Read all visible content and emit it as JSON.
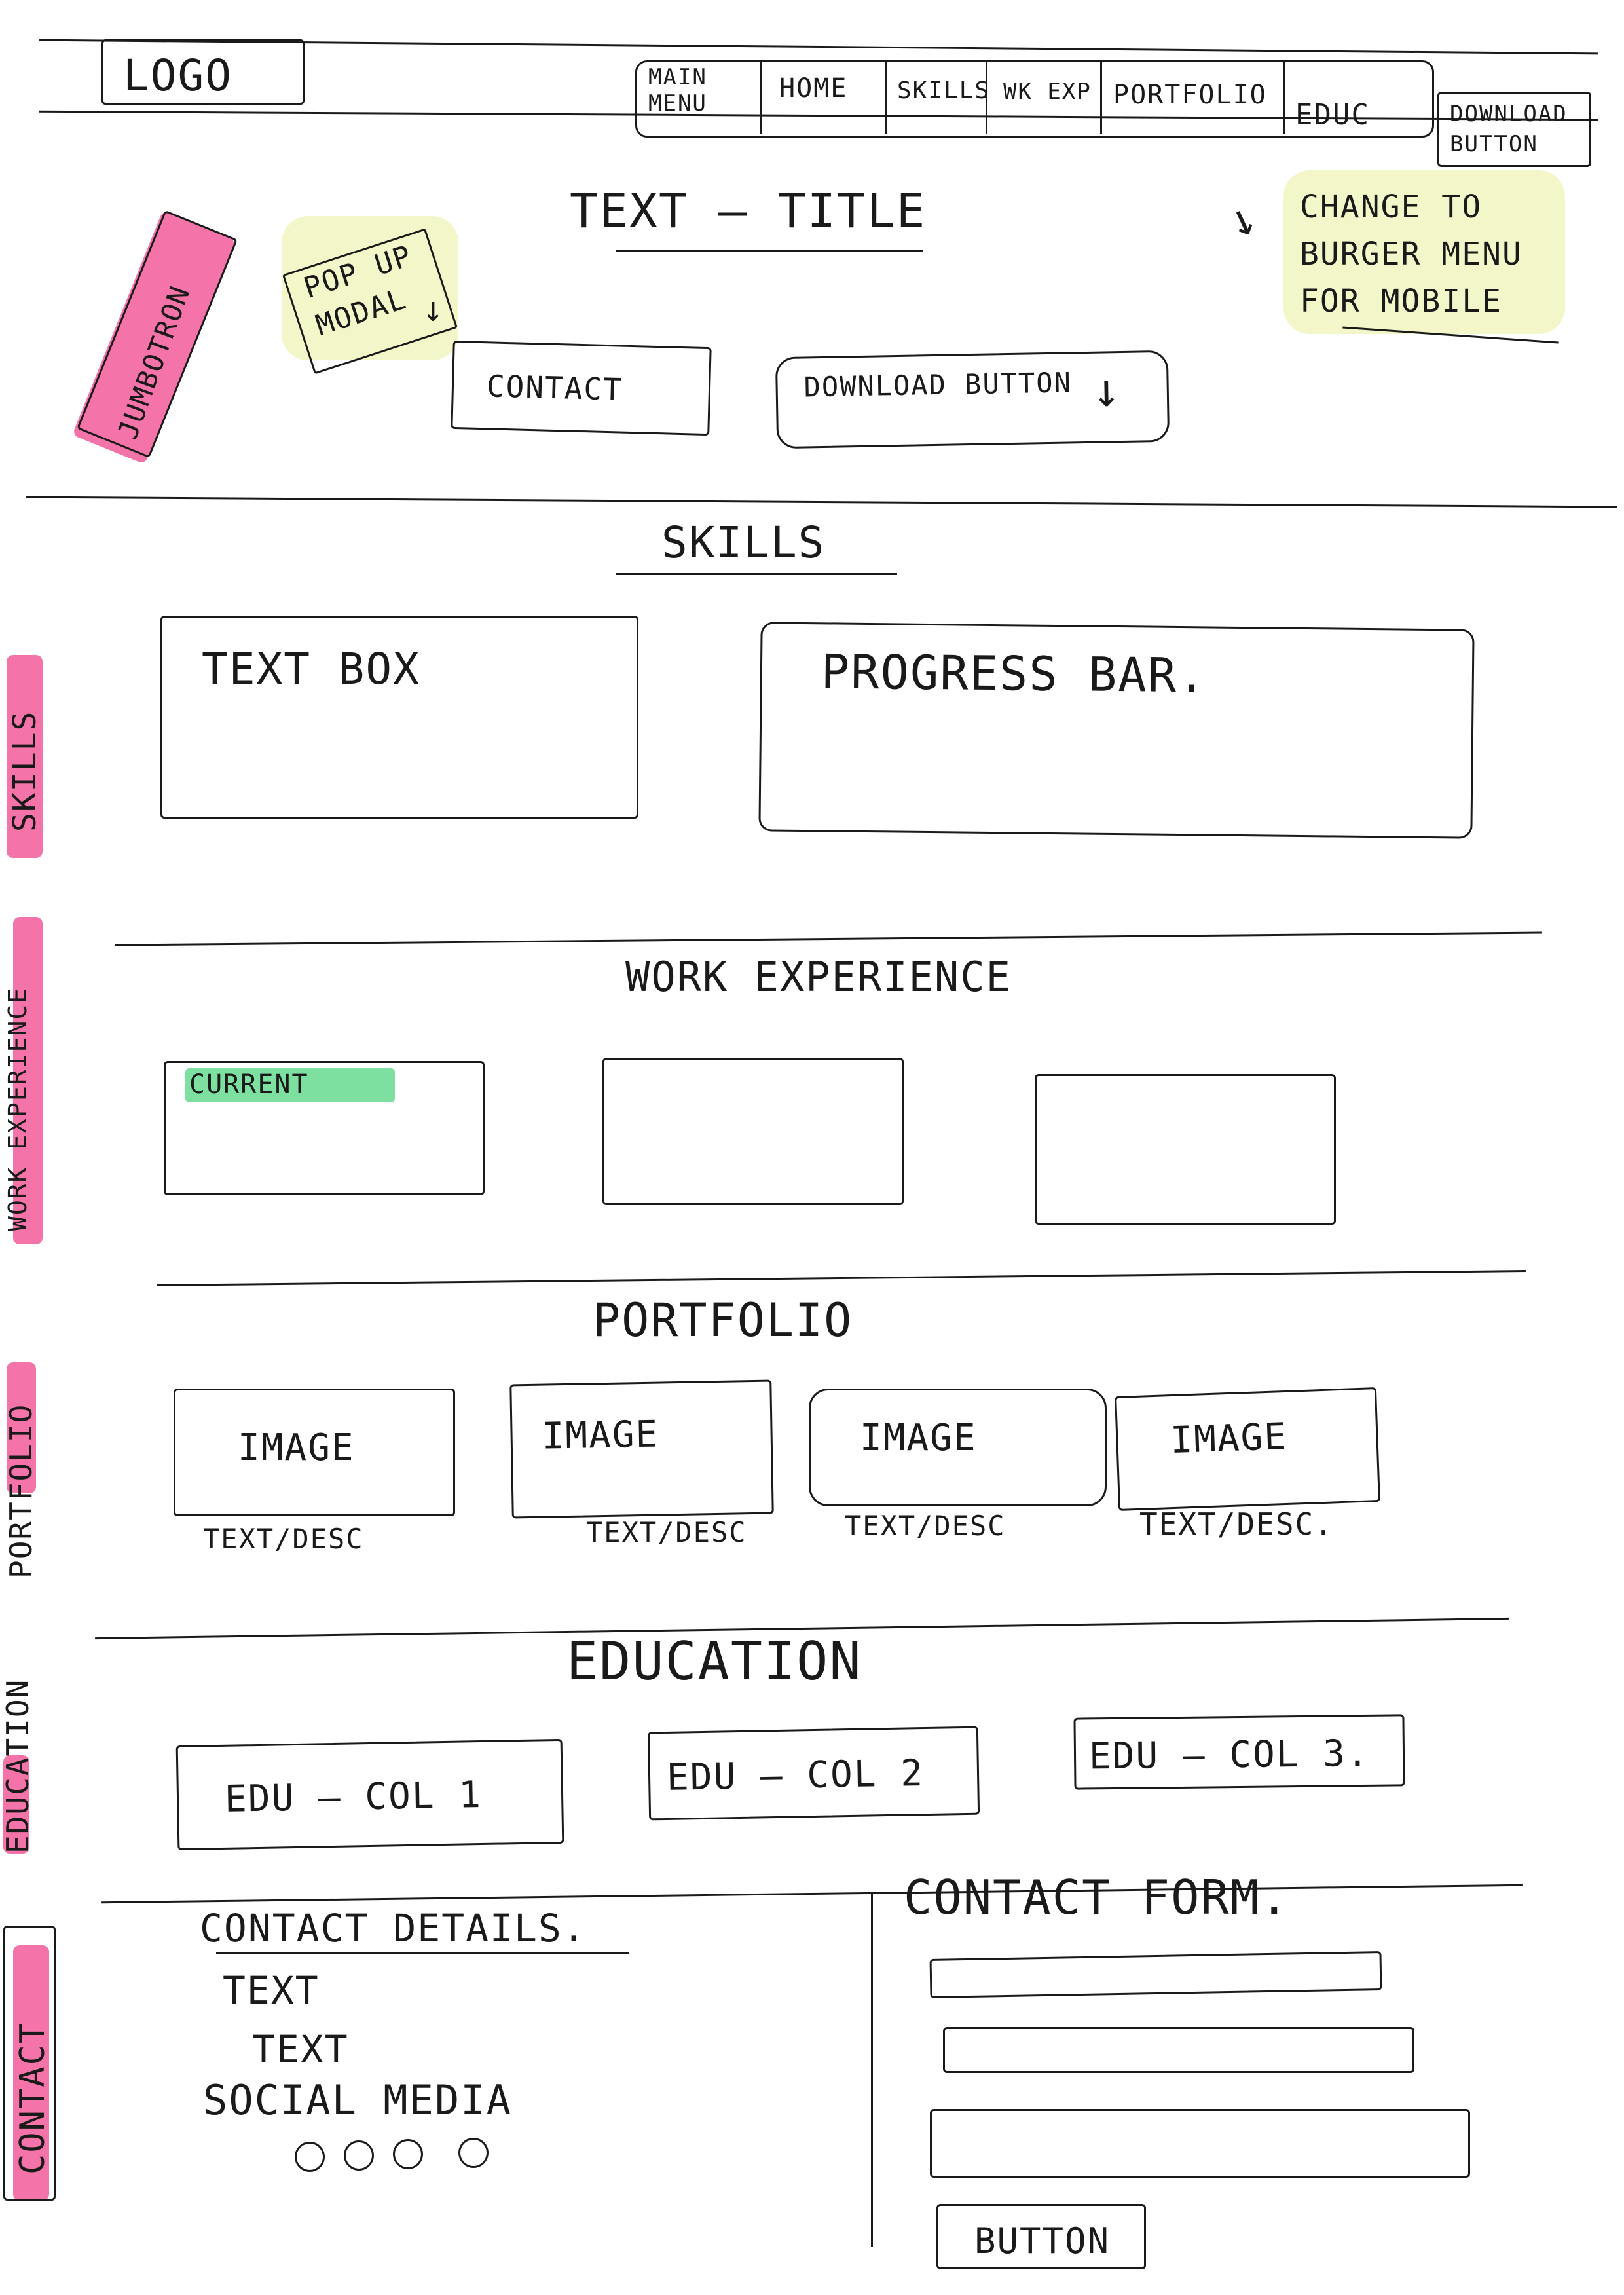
{
  "header": {
    "logo": "LOGO",
    "nav": [
      "MAIN MENU",
      "HOME",
      "SKILLS",
      "WK EXP",
      "PORTFOLIO",
      "EDUC"
    ],
    "download": "DOWNLOAD BUTTON"
  },
  "hero": {
    "title": "TEXT — TITLE",
    "contact_button": "CONTACT",
    "download_button": "DOWNLOAD BUTTON",
    "popup_note": "POP UP MODAL",
    "jumbotron_note": "JUMBOTRON",
    "mobile_note": "CHANGE TO BURGER MENU FOR MOBILE"
  },
  "skills": {
    "heading": "SKILLS",
    "text_box": "TEXT BOX",
    "progress_bar": "PROGRESS BAR."
  },
  "work": {
    "heading": "WORK EXPERIENCE",
    "current": "CURRENT"
  },
  "portfolio": {
    "heading": "PORTFOLIO",
    "items": [
      {
        "image": "IMAGE",
        "desc": "TEXT/DESC"
      },
      {
        "image": "IMAGE",
        "desc": "TEXT/DESC"
      },
      {
        "image": "IMAGE",
        "desc": "TEXT/DESC"
      },
      {
        "image": "IMAGE",
        "desc": "TEXT/DESC."
      }
    ]
  },
  "education": {
    "heading": "EDUCATION",
    "cols": [
      "EDU — COL 1",
      "EDU — COL 2",
      "EDU — COL 3."
    ]
  },
  "contact": {
    "details_heading": "CONTACT DETAILS.",
    "text1": "TEXT",
    "text2": "TEXT",
    "social": "SOCIAL MEDIA",
    "form_heading": "CONTACT FORM.",
    "button": "BUTTON"
  },
  "side_labels": {
    "skills": "SKILLS",
    "work": "WORK EXPERIENCE",
    "portfolio": "PORTFOLIO",
    "education": "EDUCATION",
    "contact": "CONTACT"
  }
}
